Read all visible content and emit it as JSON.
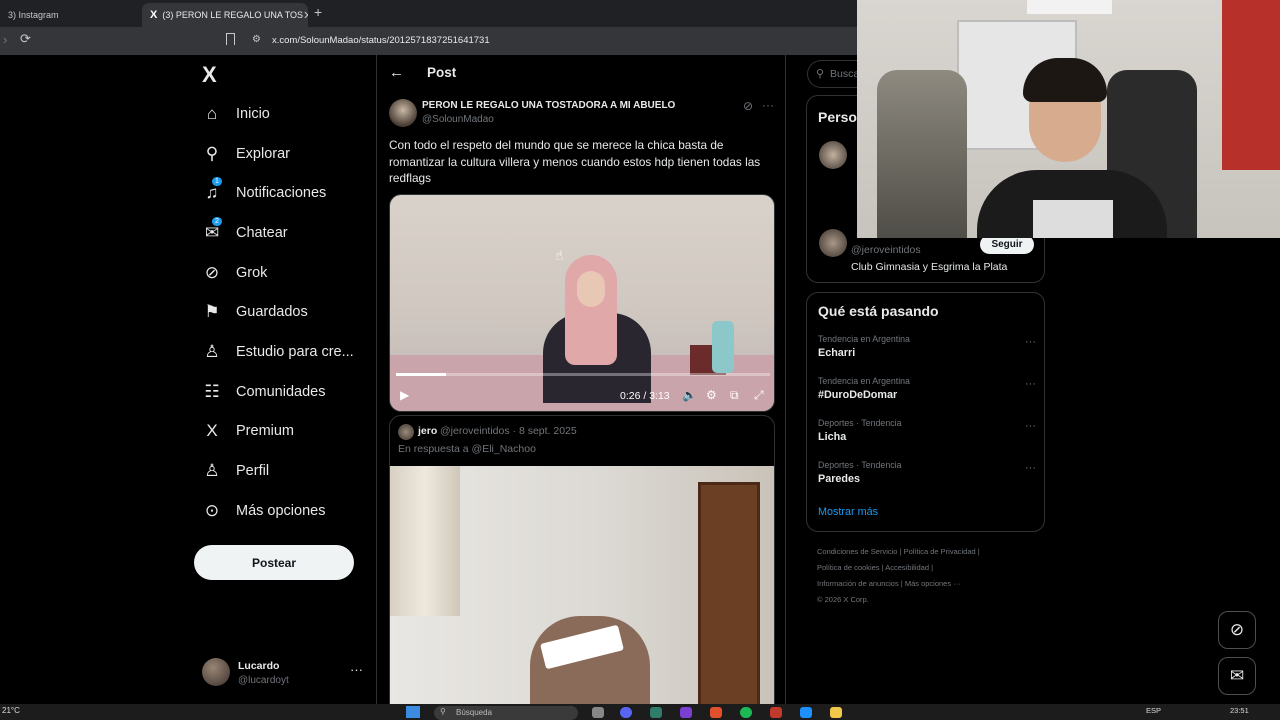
{
  "browser": {
    "tabs": [
      {
        "label": "3) Instagram",
        "active": false
      },
      {
        "label": "(3) PERON LE REGALO UNA TOS",
        "active": true
      }
    ],
    "new_tab": "+",
    "url": "x.com/SolounMadao/status/2012571837251641731"
  },
  "sidebar": {
    "logo": "X",
    "items": [
      {
        "label": "Inicio",
        "icon": "home-icon",
        "glyph": "⌂"
      },
      {
        "label": "Explorar",
        "icon": "search-icon",
        "glyph": "⚲"
      },
      {
        "label": "Notificaciones",
        "icon": "bell-icon",
        "glyph": "🔔",
        "badge": "1"
      },
      {
        "label": "Chatear",
        "icon": "mail-icon",
        "glyph": "✉",
        "badge": "2"
      },
      {
        "label": "Grok",
        "icon": "grok-icon",
        "glyph": "⊘"
      },
      {
        "label": "Guardados",
        "icon": "bookmark-icon",
        "glyph": "⚑"
      },
      {
        "label": "Estudio para cre...",
        "icon": "studio-icon",
        "glyph": "♙"
      },
      {
        "label": "Comunidades",
        "icon": "communities-icon",
        "glyph": "☷"
      },
      {
        "label": "Premium",
        "icon": "x-premium-icon",
        "glyph": "X"
      },
      {
        "label": "Perfil",
        "icon": "person-icon",
        "glyph": "♙"
      },
      {
        "label": "Más opciones",
        "icon": "more-circle-icon",
        "glyph": "⊙"
      }
    ],
    "post_button": "Postear",
    "profile": {
      "name": "Lucardo",
      "handle": "@lucardoyt",
      "more": "···"
    }
  },
  "main": {
    "back": "←",
    "title": "Post",
    "author": {
      "name": "PERON LE REGALO UNA TOSTADORA A MI ABUELO",
      "handle": "@SolounMadao"
    },
    "text": "Con todo el respeto del mundo que se merece la chica basta de romantizar la cultura villera y menos cuando estos hdp tienen todas las redflags",
    "video": {
      "time": "0:26 / 3:13",
      "progress": 0.134
    },
    "quoted": {
      "name": "jero",
      "meta": "@jeroveintidos · 8 sept. 2025",
      "reply_to": "En respuesta a @Eli_Nachoo"
    }
  },
  "right": {
    "search_placeholder": "Busca",
    "who_to_follow": {
      "title": "Perso",
      "handle": "@jeroveintidos",
      "description": "Club Gimnasia y Esgrima la Plata",
      "follow": "Seguir"
    },
    "trends": {
      "title": "Qué está pasando",
      "items": [
        {
          "category": "Tendencia en Argentina",
          "name": "Echarri"
        },
        {
          "category": "Tendencia en Argentina",
          "name": "#DuroDeDomar"
        },
        {
          "category": "Deportes · Tendencia",
          "name": "Licha"
        },
        {
          "category": "Deportes · Tendencia",
          "name": "Paredes"
        }
      ],
      "show_more": "Mostrar más"
    },
    "footer": [
      "Condiciones de Servicio  |  Política de Privacidad  |",
      "Política de cookies  |  Accesibilidad  |",
      "Información de anuncios  |  Más opciones ···",
      "© 2026 X Corp."
    ]
  },
  "taskbar": {
    "weather": "21°C",
    "search_placeholder": "Búsqueda",
    "language": "ESP",
    "clock": "23:51"
  }
}
